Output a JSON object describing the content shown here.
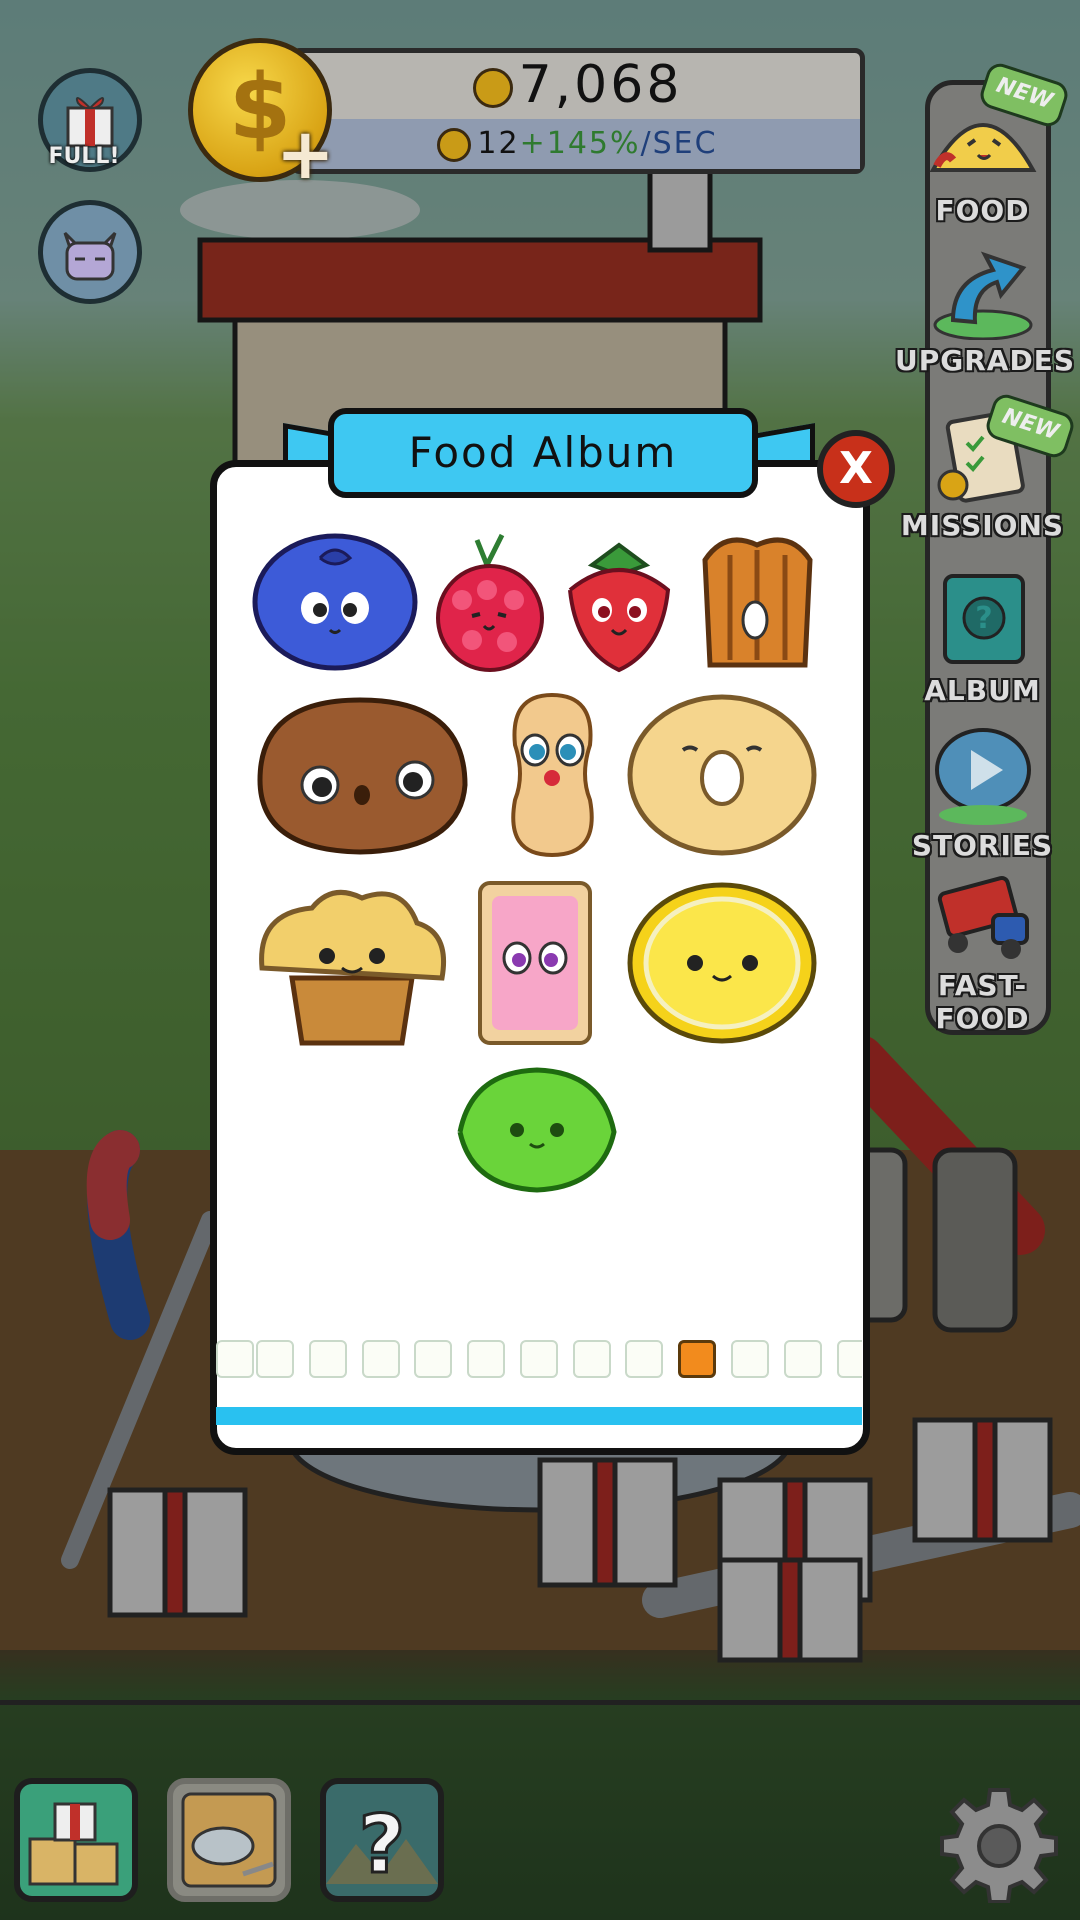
{
  "header": {
    "coins": "7,068",
    "rate_base": "12",
    "rate_bonus": "+145%",
    "rate_unit": "/SEC"
  },
  "left_buttons": {
    "gift_label": "FULL!"
  },
  "menu": {
    "items": [
      {
        "label": "FOOD",
        "badge": "NEW",
        "icon": "taco-icon"
      },
      {
        "label": "UPGRADES",
        "icon": "arrow-up-icon"
      },
      {
        "label": "MISSIONS",
        "badge": "NEW",
        "icon": "clipboard-icon"
      },
      {
        "label": "ALBUM",
        "icon": "album-book-icon"
      },
      {
        "label": "STORIES",
        "icon": "play-bubble-icon"
      },
      {
        "label": "FAST-FOOD",
        "icon": "truck-icon"
      }
    ]
  },
  "modal": {
    "title": "Food Album",
    "close_label": "X",
    "foods": [
      "blueberry",
      "raspberry",
      "strawberry",
      "pecan",
      "walnut",
      "peanut",
      "donut",
      "muffin",
      "toaster-pastry",
      "lemon-slice",
      "lime"
    ],
    "page_thumbnails_count": 13,
    "selected_thumbnail": 10,
    "colors": {
      "ribbon": "#3ec8f2",
      "close": "#c8301a",
      "selected_thumb": "#f28b1d"
    }
  },
  "bottom_bar": {
    "buttons": [
      "gifts-button",
      "table-button",
      "mystery-button"
    ],
    "help_symbol": "?"
  }
}
